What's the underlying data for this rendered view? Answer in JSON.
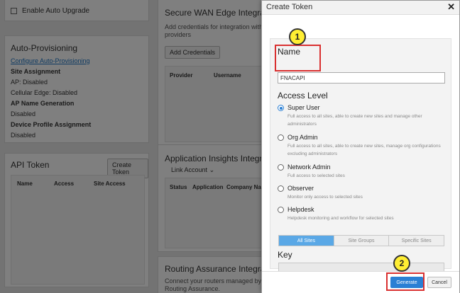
{
  "background": {
    "upgrade": {
      "checkbox_label": "Enable Auto Upgrade"
    },
    "auto_provisioning": {
      "title": "Auto-Provisioning",
      "configure_link": "Configure Auto-Provisioning",
      "site_assignment_heading": "Site Assignment",
      "ap_line": "AP: Disabled",
      "cellular_line": "Cellular Edge: Disabled",
      "ap_name_heading": "AP Name Generation",
      "ap_name_value": "Disabled",
      "device_profile_heading": "Device Profile Assignment",
      "device_profile_value": "Disabled"
    },
    "api_token": {
      "title": "API Token",
      "create_button": "Create Token",
      "columns": [
        "Name",
        "Access",
        "Site Access"
      ]
    },
    "wan_edge": {
      "title": "Secure WAN Edge Integration",
      "description_line1": "Add credentials for integration with sec",
      "description_line2": "providers",
      "add_button": "Add Credentials",
      "columns": [
        "Provider",
        "Username"
      ]
    },
    "app_insights": {
      "title": "Application Insights Integratio",
      "link_account": "Link Account",
      "columns": [
        "Status",
        "Application",
        "Company Name"
      ]
    },
    "routing": {
      "title": "Routing Assurance Integration",
      "description_line1": "Connect your routers managed by Ju",
      "description_line2": "Routing Assurance."
    }
  },
  "modal": {
    "title": "Create Token",
    "close_glyph": "✕",
    "name_label": "Name",
    "name_value": "FNACAPI",
    "access_level_label": "Access Level",
    "options": [
      {
        "label": "Super User",
        "desc": "Full access to all sites, able to create new sites and manage other administrators",
        "selected": true
      },
      {
        "label": "Org Admin",
        "desc": "Full access to all sites, able to create new sites, manage org configurations excluding administrators",
        "selected": false
      },
      {
        "label": "Network Admin",
        "desc": "Full access to selected sites",
        "selected": false
      },
      {
        "label": "Observer",
        "desc": "Monitor only access to selected sites",
        "selected": false
      },
      {
        "label": "Helpdesk",
        "desc": "Helpdesk monitoring and workflow for selected sites",
        "selected": false
      }
    ],
    "site_tabs": [
      "All Sites",
      "Site Groups",
      "Specific Sites"
    ],
    "active_site_tab": "All Sites",
    "key_label": "Key",
    "key_value": "",
    "generate_button": "Generate",
    "cancel_button": "Cancel"
  },
  "annotations": {
    "step1": "1",
    "step2": "2"
  },
  "colors": {
    "accent": "#2a7fd4",
    "annotation_red": "#d93030",
    "annotation_yellow": "#ffee33"
  }
}
